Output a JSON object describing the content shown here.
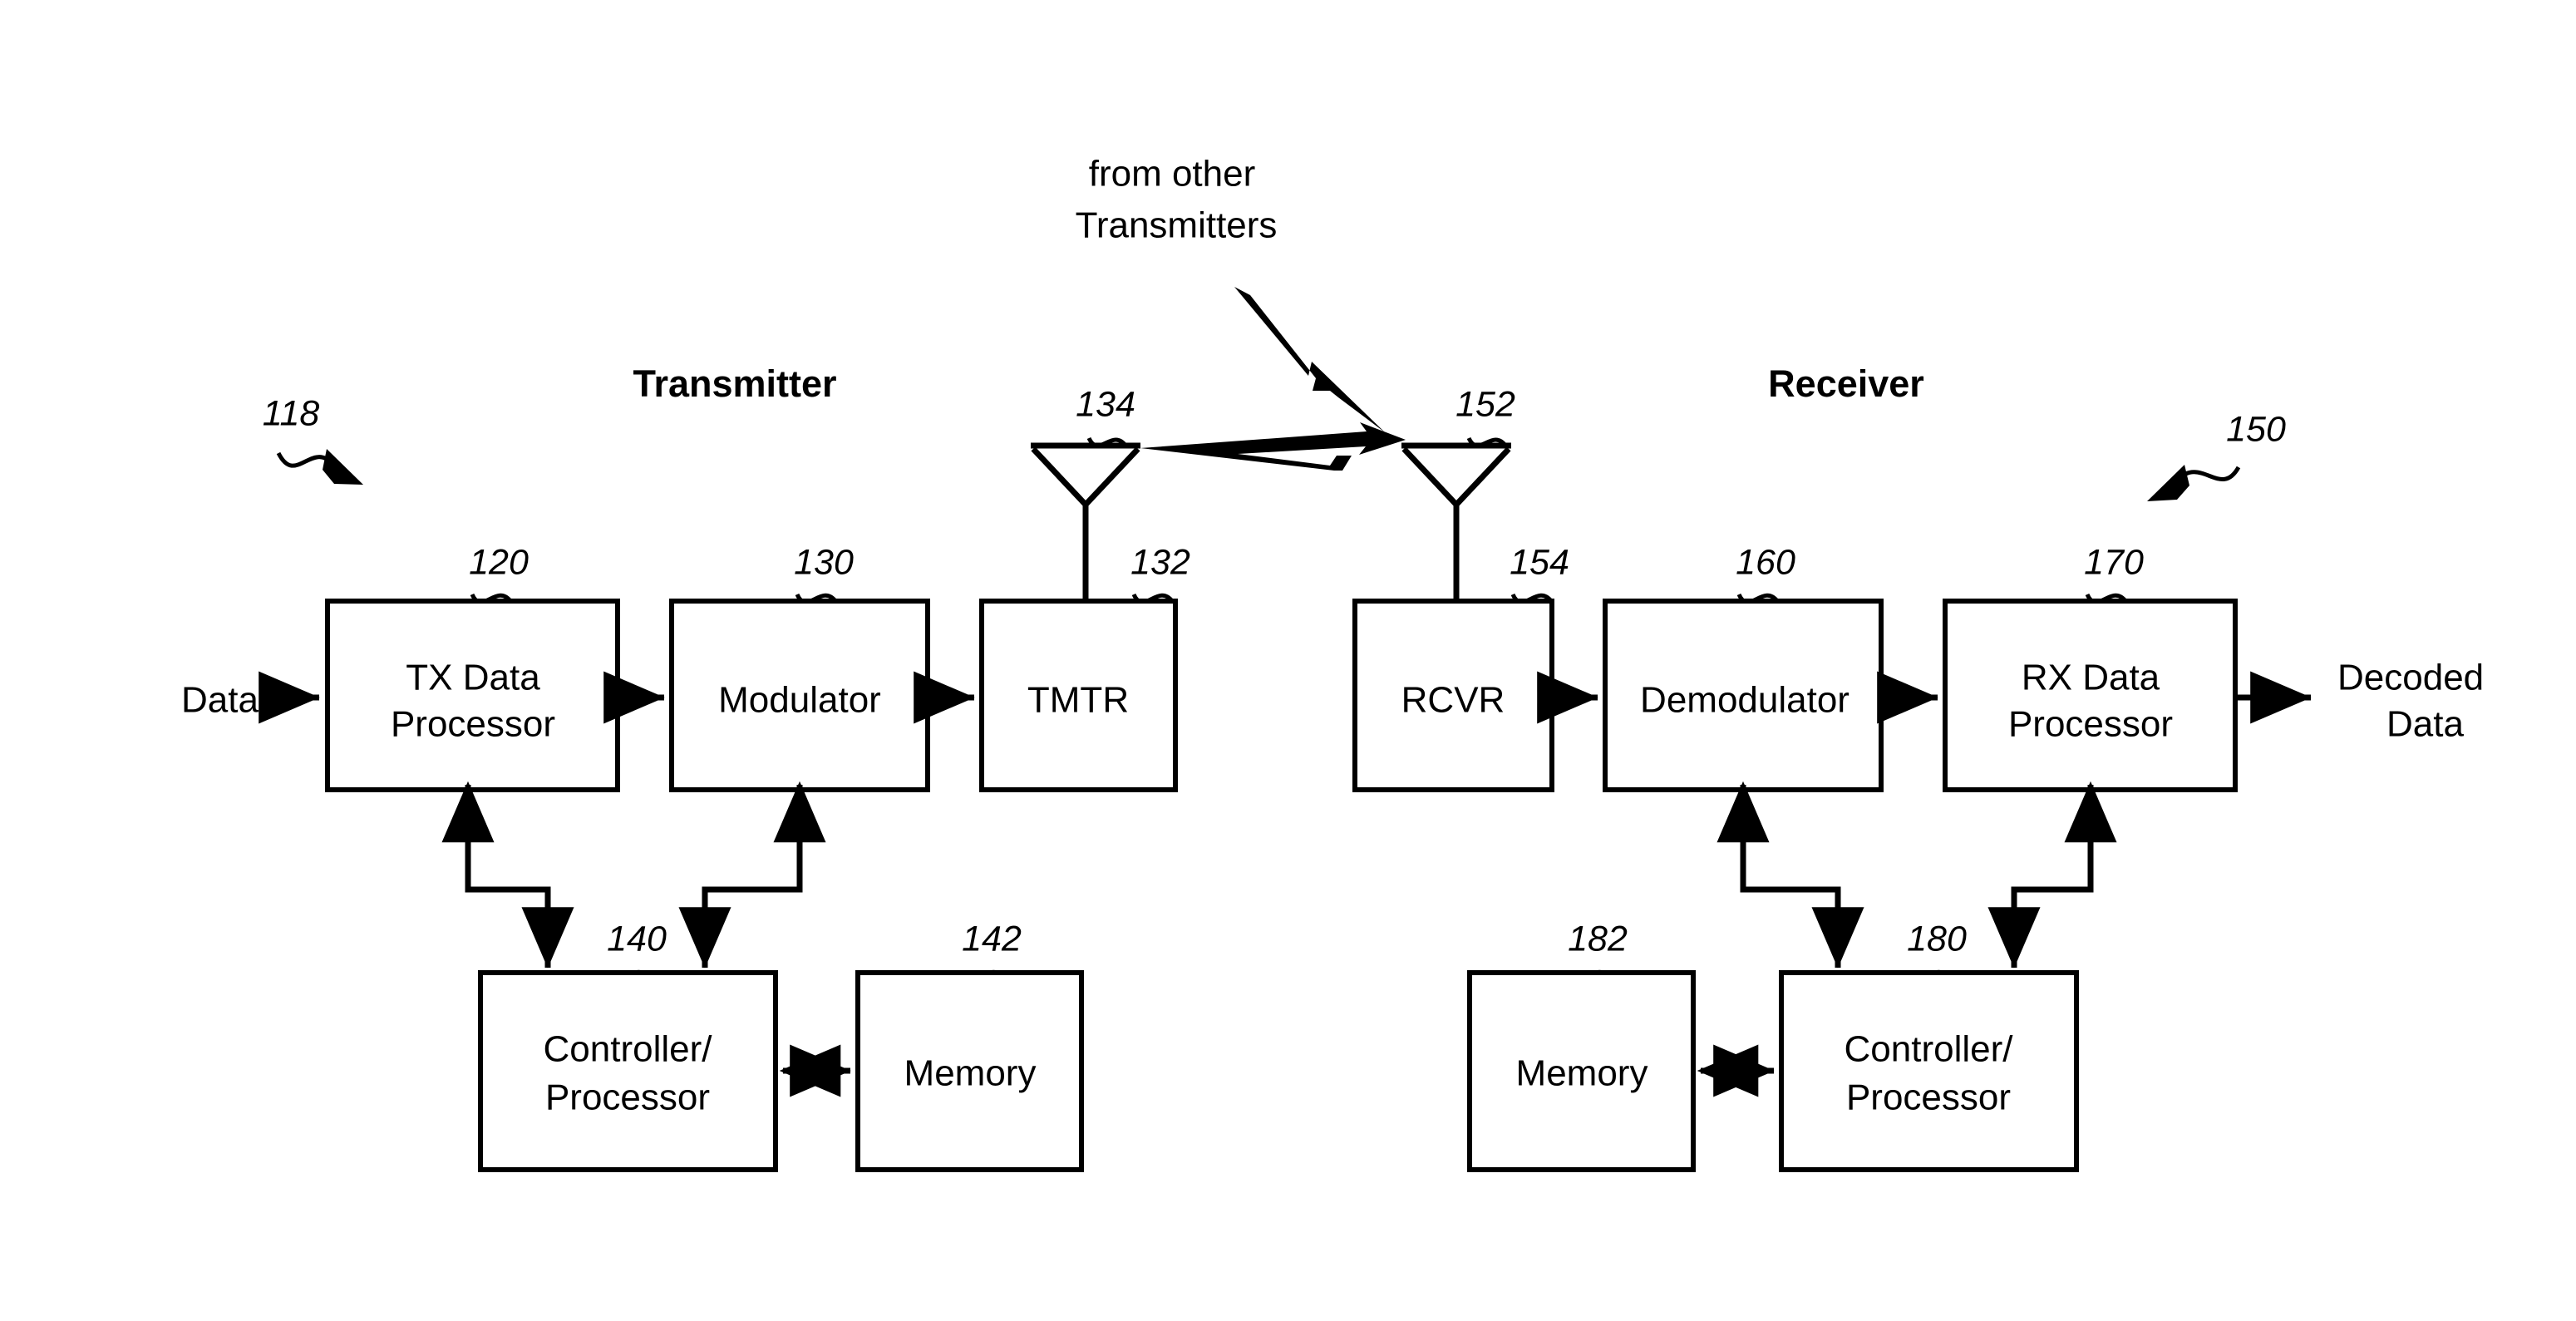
{
  "figure": {
    "type": "block-diagram",
    "title": "Transmitter and Receiver block diagram",
    "background_color": "#ffffff",
    "line_color": "#000000"
  },
  "sections": {
    "transmitter_title": "Transmitter",
    "receiver_title": "Receiver"
  },
  "blocks": {
    "tx_data_processor": {
      "line1": "TX Data",
      "line2": "Processor",
      "ref": "120"
    },
    "modulator": {
      "label": "Modulator",
      "ref": "130"
    },
    "tmtr": {
      "label": "TMTR",
      "ref": "132"
    },
    "rcvr": {
      "label": "RCVR",
      "ref": "154"
    },
    "demodulator": {
      "label": "Demodulator",
      "ref": "160"
    },
    "rx_data_processor": {
      "line1": "RX Data",
      "line2": "Processor",
      "ref": "170"
    },
    "tx_controller": {
      "line1": "Controller/",
      "line2": "Processor",
      "ref": "140"
    },
    "tx_memory": {
      "label": "Memory",
      "ref": "142"
    },
    "rx_memory": {
      "label": "Memory",
      "ref": "182"
    },
    "rx_controller": {
      "line1": "Controller/",
      "line2": "Processor",
      "ref": "180"
    }
  },
  "antennas": {
    "tx_antenna_ref": "134",
    "rx_antenna_ref": "152"
  },
  "callouts": {
    "transmitter_system_ref": "118",
    "receiver_system_ref": "150"
  },
  "io_labels": {
    "data_in": "Data",
    "decoded_data_line1": "Decoded",
    "decoded_data_line2": "Data"
  },
  "annotations": {
    "interference_line1": "from other",
    "interference_line2": "Transmitters"
  }
}
